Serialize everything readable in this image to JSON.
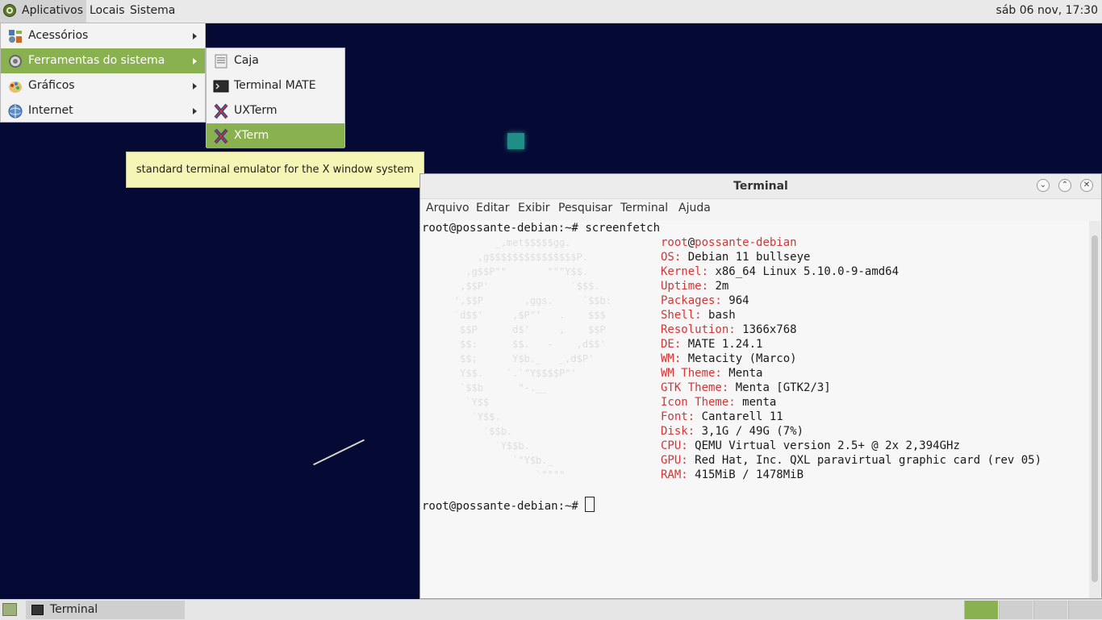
{
  "top_panel": {
    "menus": [
      "Aplicativos",
      "Locais",
      "Sistema"
    ],
    "clock": "sáb 06 nov, 17:30"
  },
  "apps_menu": {
    "items": [
      {
        "label": "Acessórios",
        "icon": "accessories-icon"
      },
      {
        "label": "Ferramentas do sistema",
        "icon": "system-tools-icon"
      },
      {
        "label": "Gráficos",
        "icon": "graphics-icon"
      },
      {
        "label": "Internet",
        "icon": "internet-icon"
      }
    ]
  },
  "sub_menu": {
    "items": [
      {
        "label": "Caja",
        "icon": "caja-icon"
      },
      {
        "label": "Terminal MATE",
        "icon": "terminal-mate-icon"
      },
      {
        "label": "UXTerm",
        "icon": "uxterm-icon"
      },
      {
        "label": "XTerm",
        "icon": "xterm-icon"
      }
    ]
  },
  "tooltip": "standard terminal emulator for the X window system",
  "terminal": {
    "title": "Terminal",
    "menu": [
      "Arquivo",
      "Editar",
      "Exibir",
      "Pesquisar",
      "Terminal",
      "Ajuda"
    ],
    "prompt": "root@possante-debian:~#",
    "command": "screenfetch",
    "user": "root",
    "at": "@",
    "host": "possante-debian",
    "info": [
      {
        "label": "OS:",
        "value": "Debian 11 bullseye"
      },
      {
        "label": "Kernel:",
        "value": "x86_64 Linux 5.10.0-9-amd64"
      },
      {
        "label": "Uptime:",
        "value": "2m"
      },
      {
        "label": "Packages:",
        "value": "964"
      },
      {
        "label": "Shell:",
        "value": "bash"
      },
      {
        "label": "Resolution:",
        "value": "1366x768"
      },
      {
        "label": "DE:",
        "value": "MATE 1.24.1"
      },
      {
        "label": "WM:",
        "value": "Metacity (Marco)"
      },
      {
        "label": "WM Theme:",
        "value": "Menta"
      },
      {
        "label": "GTK Theme:",
        "value": "Menta [GTK2/3]"
      },
      {
        "label": "Icon Theme:",
        "value": "menta"
      },
      {
        "label": "Font:",
        "value": "Cantarell 11"
      },
      {
        "label": "Disk:",
        "value": "3,1G / 49G (7%)"
      },
      {
        "label": "CPU:",
        "value": "QEMU Virtual version 2.5+ @ 2x 2,394GHz"
      },
      {
        "label": "GPU:",
        "value": "Red Hat, Inc. QXL paravirtual graphic card (rev 05)"
      },
      {
        "label": "RAM:",
        "value": "415MiB / 1478MiB"
      }
    ],
    "ascii_logo": "           _,met$$$$$gg.\n        ,g$$$$$$$$$$$$$$$P.\n      ,g$$P\"\"       \"\"\"Y$$.\n     ,$$P'              `$$$.\n    ',$$P       ,ggs.     `$$b:\n    `d$$'     ,$P\"'   .    $$$\n     $$P      d$'     ,    $$P\n     $$:      $$.   -    ,d$$'\n     $$;      Y$b._   _,d$P'\n     Y$$.    `.`\"Y$$$$P\"'\n     `$$b      \"-.__\n      `Y$$\n       `Y$$.\n         `$$b.\n           `Y$$b.\n              `\"Y$b._\n                  `\"\"\"\""
  },
  "taskbar": {
    "window_label": "Terminal",
    "workspaces": 4
  }
}
